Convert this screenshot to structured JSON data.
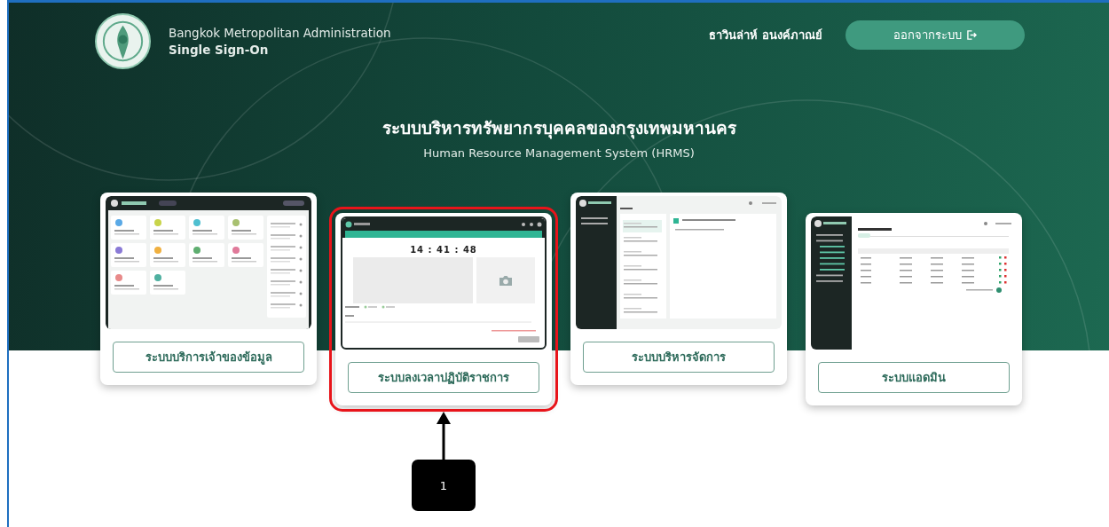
{
  "header": {
    "org_name": "Bangkok Metropolitan Administration",
    "app_name": "Single Sign-On",
    "user_name": "ธาวินล่าห์ อนงค์ภาณย์",
    "logout_button": "ออกจากระบบ"
  },
  "hero": {
    "title": "ระบบบริหารทรัพยากรบุคคลของกรุงเทพมหานคร",
    "subtitle": "Human Resource Management System (HRMS)"
  },
  "systems": [
    {
      "kind": "dashboard",
      "label": "ระบบบริการเจ้าของข้อมูล",
      "highlighted": false
    },
    {
      "kind": "attendance",
      "label": "ระบบลงเวลาปฏิบัติราชการ",
      "highlighted": true,
      "clock": "14 : 41 : 48"
    },
    {
      "kind": "inbox",
      "label": "ระบบบริหารจัดการ",
      "highlighted": false
    },
    {
      "kind": "table",
      "label": "ระบบแอดมิน",
      "highlighted": false
    }
  ],
  "callout": {
    "label": "1"
  }
}
